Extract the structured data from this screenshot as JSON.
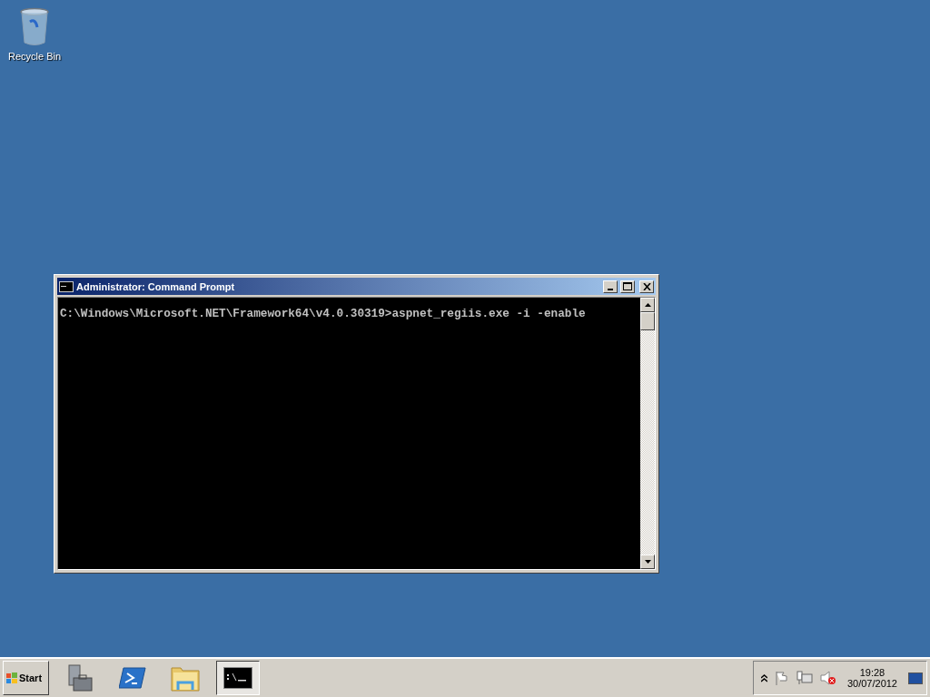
{
  "desktop_icons": [
    {
      "label": "Recycle Bin"
    }
  ],
  "window": {
    "title": "Administrator: Command Prompt",
    "console_lines": [
      "C:\\Windows\\Microsoft.NET\\Framework64\\v4.0.30319>aspnet_regiis.exe -i -enable"
    ]
  },
  "taskbar": {
    "start_label": "Start",
    "apps": [
      {
        "kind": "server",
        "selected": false
      },
      {
        "kind": "shell",
        "selected": false
      },
      {
        "kind": "folder",
        "selected": false
      },
      {
        "kind": "console",
        "selected": true
      }
    ],
    "clock": {
      "time": "19:28",
      "date": "30/07/2012"
    }
  }
}
